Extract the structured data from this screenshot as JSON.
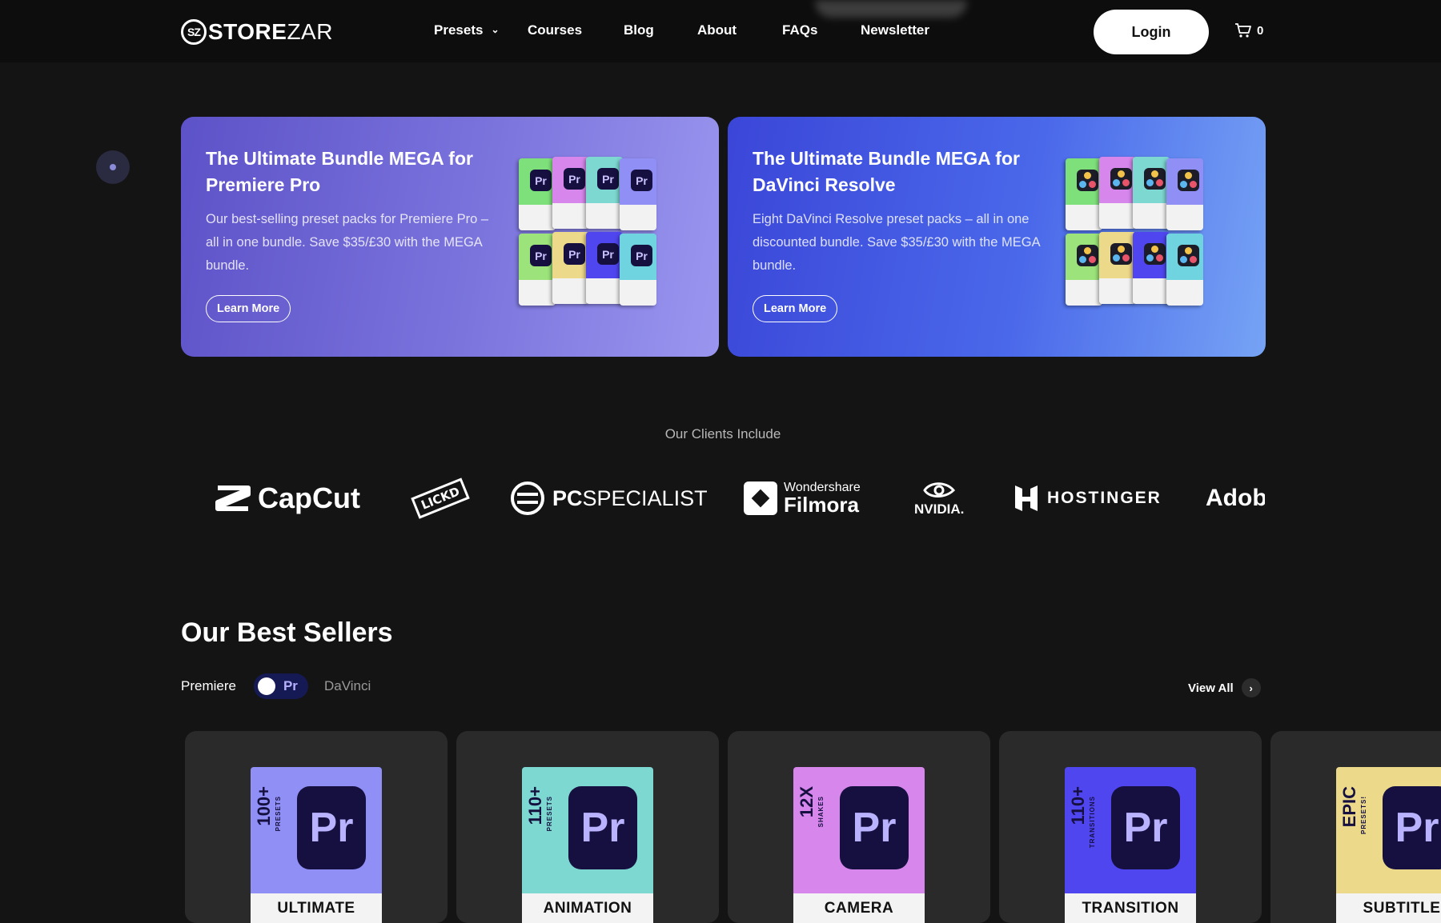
{
  "header": {
    "logo_mark": "SZ",
    "logo_bold": "STORE",
    "logo_light": "ZAR",
    "nav": [
      "Presets",
      "Courses",
      "Blog",
      "About",
      "FAQs",
      "Newsletter"
    ],
    "login_label": "Login",
    "cart_count": "0"
  },
  "banners": [
    {
      "title": "The Ultimate Bundle MEGA for Premiere Pro",
      "description": "Our best-selling preset packs for Premiere Pro – all in one bundle. Save $35/£30 with the MEGA bundle.",
      "button": "Learn More",
      "app_icon": "Pr"
    },
    {
      "title": "The Ultimate Bundle MEGA for DaVinci Resolve",
      "description": "Eight DaVinci Resolve preset packs – all in one discounted bundle. Save $35/£30 with the MEGA bundle.",
      "button": "Learn More",
      "app_icon": "davinci-icon"
    }
  ],
  "clients": {
    "title": "Our Clients Include",
    "logos": [
      {
        "name": "CapCut",
        "text": "CapCut"
      },
      {
        "name": "Lickd",
        "text": "LICKD"
      },
      {
        "name": "PCSpecialist",
        "text_bold": "PC",
        "text_light": "SPECIALIST"
      },
      {
        "name": "Wondershare Filmora",
        "text_small": "Wondershare",
        "text": "Filmora"
      },
      {
        "name": "NVIDIA",
        "text": "NVIDIA."
      },
      {
        "name": "Hostinger",
        "text": "HOSTINGER"
      },
      {
        "name": "Adobe",
        "text": "Adobe"
      }
    ]
  },
  "best_sellers": {
    "title": "Our Best Sellers",
    "toggle_left": "Premiere",
    "toggle_icon": "Pr",
    "toggle_right": "DaVinci",
    "view_all": "View All",
    "products": [
      {
        "side": "100+",
        "sub": "PRESETS",
        "label": "ULTIMATE",
        "color": "#8f8ff5"
      },
      {
        "side": "110+",
        "sub": "PRESETS",
        "label": "ANIMATION",
        "color": "#7dd8d2"
      },
      {
        "side": "12X",
        "sub": "SHAKES",
        "label": "CAMERA",
        "color": "#d786ec"
      },
      {
        "side": "110+",
        "sub": "TRANSITIONS",
        "label": "TRANSITION",
        "color": "#5046f0"
      },
      {
        "side": "EPIC",
        "sub": "PRESETS!",
        "label": "SUBTITLE",
        "color": "#ecd98a"
      }
    ],
    "product_app_icon": "Pr"
  },
  "colors": {
    "background": "#141414",
    "header_bg": "#0d0d0d",
    "banner_1_start": "#5d52c8",
    "banner_2_start": "#3b46d8",
    "toggle_bg": "#151a55"
  }
}
